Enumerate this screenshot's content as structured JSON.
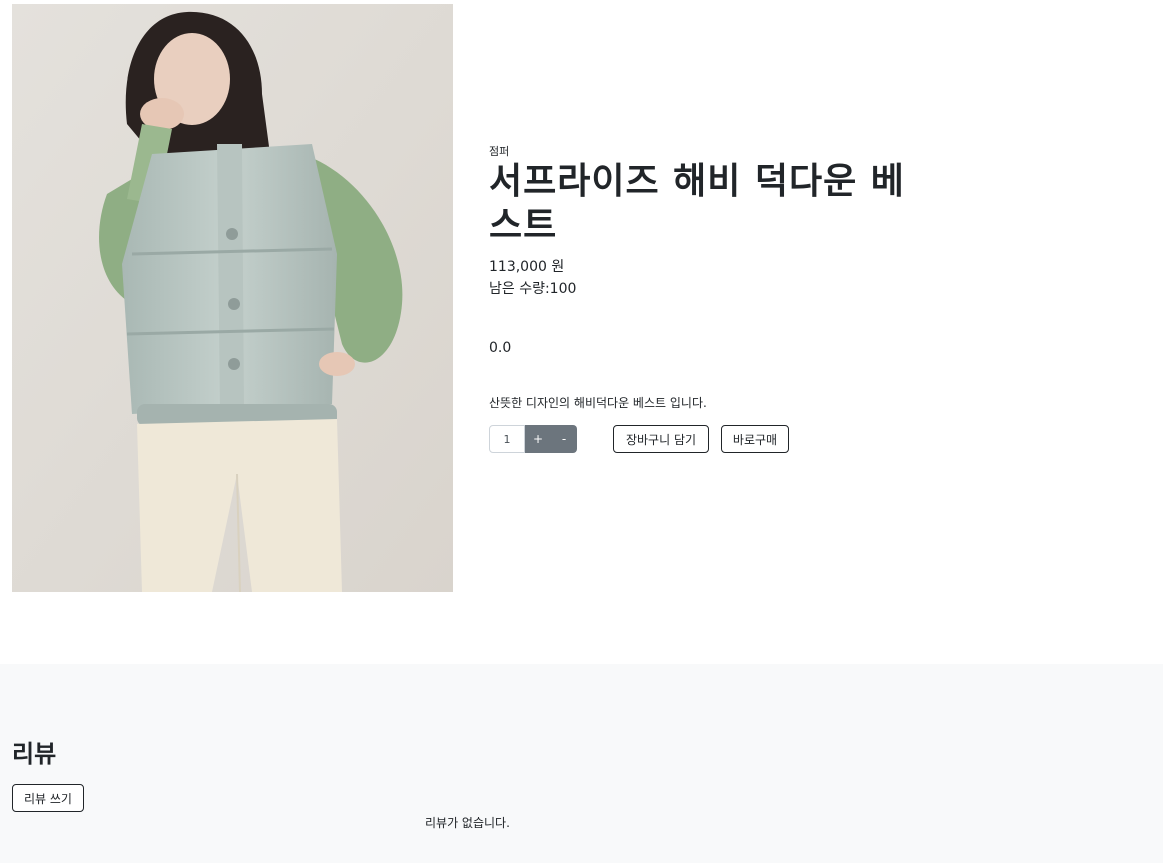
{
  "product": {
    "image_alt": "서프라이즈 해비 덕다운 베스트",
    "category": "점퍼",
    "name": "서프라이즈 해비 덕다운 베스트",
    "price": "113,000 원",
    "stock": "남은 수량:100",
    "rating": "0.0",
    "description": "산뜻한 디자인의 해비덕다운 베스트 입니다."
  },
  "quantity": {
    "value": "1",
    "plus_label": "+",
    "minus_label": "-"
  },
  "actions": {
    "cart_label": "장바구니 담기",
    "buy_label": "바로구매"
  },
  "reviews": {
    "heading": "리뷰",
    "write_label": "리뷰 쓰기",
    "empty_text": "리뷰가 없습니다."
  },
  "colors": {
    "stepper_bg": "#6c757d",
    "review_bg": "#f8f9fa",
    "text": "#212529"
  }
}
